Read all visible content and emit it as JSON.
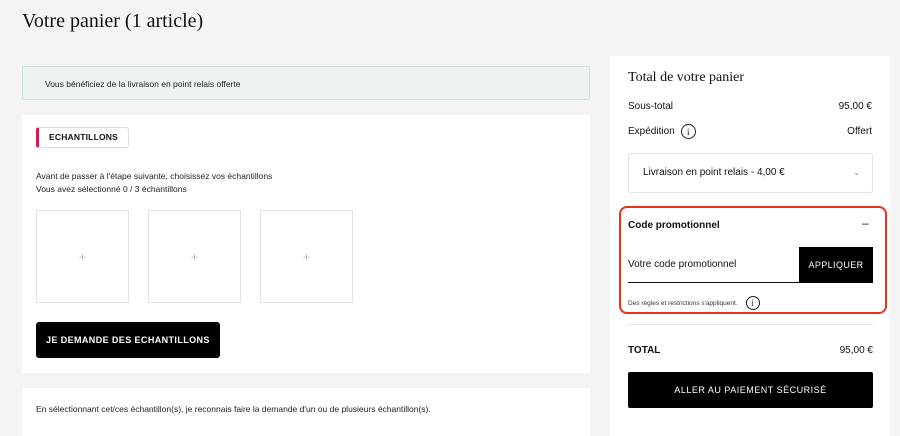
{
  "page": {
    "title": "Votre panier (1 article)"
  },
  "banner": {
    "text": "Vous bénéficiez de la livraison en point relais offerte"
  },
  "samples": {
    "tag": "ECHANTILLONS",
    "intro_line1": "Avant de passer à l'étape suivante, choisissez vos échantillons",
    "intro_line2": "Vous avez sélectionné 0 / 3 échantillons",
    "slots": [
      "+",
      "+",
      "+"
    ],
    "button_label": "JE DEMANDE DES ECHANTILLONS"
  },
  "consent": {
    "text": "En sélectionnant cet/ces échantillon(s), je reconnais faire la demande d'un ou de plusieurs échantillon(s)."
  },
  "summary": {
    "title": "Total de votre panier",
    "subtotal_label": "Sous-total",
    "subtotal_value": "95,00 €",
    "shipping_label": "Expédition",
    "shipping_value": "Offert",
    "shipping_option": "Livraison en point relais - 4,00 €",
    "promo": {
      "title": "Code promotionnel",
      "toggle": "–",
      "placeholder": "Votre code promotionnel",
      "apply_label": "APPLIQUER",
      "rules": "Des règles et restrictions s'appliquent."
    },
    "total_label": "TOTAL",
    "total_value": "95,00 €",
    "pay_label": "ALLER AU PAIEMENT SÉCURISÉ"
  },
  "icons": {
    "info": "info-icon",
    "chevron": "chevron-down-icon",
    "plus": "plus-icon"
  },
  "colors": {
    "accent_tag": "#d3174f",
    "highlight_border": "#e8321c",
    "banner_bg": "#edf4ef"
  }
}
